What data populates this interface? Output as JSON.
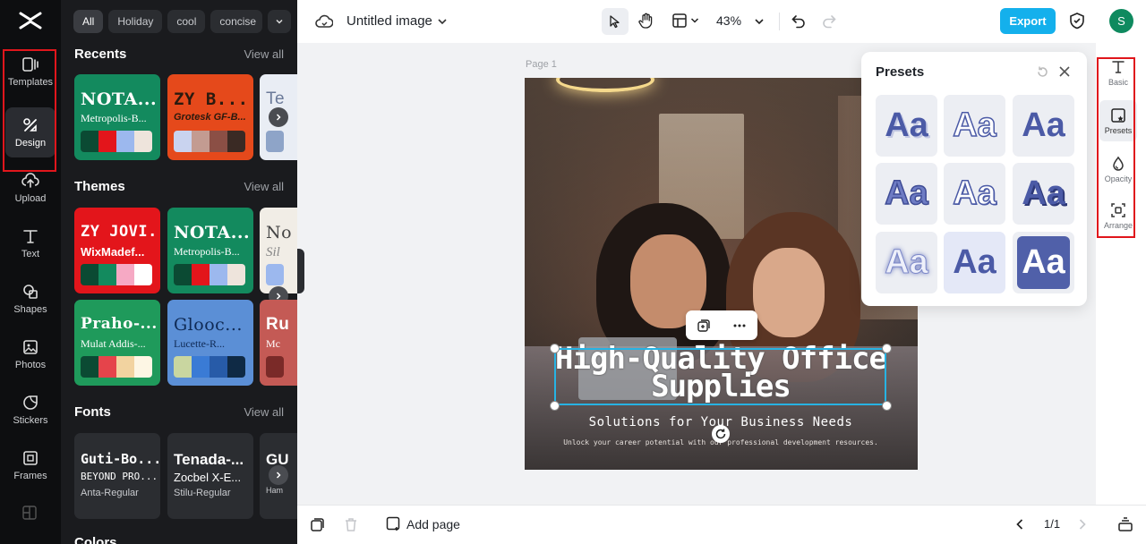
{
  "rail": {
    "items": [
      {
        "label": "Templates",
        "icon": "templates-icon"
      },
      {
        "label": "Design",
        "icon": "design-icon"
      },
      {
        "label": "Upload",
        "icon": "upload-icon"
      },
      {
        "label": "Text",
        "icon": "text-icon"
      },
      {
        "label": "Shapes",
        "icon": "shapes-icon"
      },
      {
        "label": "Photos",
        "icon": "photos-icon"
      },
      {
        "label": "Stickers",
        "icon": "stickers-icon"
      },
      {
        "label": "Frames",
        "icon": "frames-icon"
      }
    ]
  },
  "panel": {
    "chips": [
      "All",
      "Holiday",
      "cool",
      "concise"
    ],
    "recents": {
      "title": "Recents",
      "view_all": "View all",
      "cards": [
        {
          "t1": "NOTA...",
          "t2": "Metropolis-B...",
          "bg": "#138a5e",
          "fg": "#ffffff",
          "colors": [
            "#0b4a33",
            "#e3151b",
            "#9cb8ee",
            "#eee4dc"
          ]
        },
        {
          "t1": "ZY B...",
          "t2": "Grotesk GF-B...",
          "bg": "#e5491b",
          "fg": "#2a1a0f",
          "colors": [
            "#c9d3ef",
            "#c39b91",
            "#8b4f45",
            "#3a2a24"
          ]
        },
        {
          "t1": "Te",
          "t2": "",
          "bg": "#e9edf4",
          "fg": "#6b7a99",
          "colors": [
            "#8ea4c8"
          ]
        }
      ]
    },
    "themes": {
      "title": "Themes",
      "view_all": "View all",
      "cards": [
        {
          "t1": "ZY JOVI...",
          "t2": "WixMadef...",
          "bg": "#e3151b",
          "fg": "#ffffff",
          "colors": [
            "#0b4a33",
            "#138a5e",
            "#f6a9c4",
            "#ffffff"
          ]
        },
        {
          "t1": "NOTA...",
          "t2": "Metropolis-B...",
          "bg": "#138a5e",
          "fg": "#ffffff",
          "colors": [
            "#0b4a33",
            "#e3151b",
            "#9cb8ee",
            "#eee4dc"
          ]
        },
        {
          "t1": "No",
          "t2": "Sil",
          "bg": "#f1ede6",
          "fg": "#444444",
          "colors": [
            "#9cb8ee"
          ]
        },
        {
          "t1": "Praho-...",
          "t2": "Mulat Addis-...",
          "bg": "#1f9a5b",
          "fg": "#ffffff",
          "colors": [
            "#0b4a33",
            "#e5444b",
            "#f2d3a0",
            "#fdf6e4"
          ]
        },
        {
          "t1": "Glooc...",
          "t2": "Lucette-R...",
          "bg": "#5b8fd6",
          "fg": "#0f2a55",
          "colors": [
            "#c9d6a0",
            "#3a7bd5",
            "#275ba8",
            "#0f2a45"
          ]
        },
        {
          "t1": "Ru",
          "t2": "Mc",
          "bg": "#c45a55",
          "fg": "#ffffff",
          "colors": [
            "#7a2a28"
          ]
        }
      ]
    },
    "fonts": {
      "title": "Fonts",
      "view_all": "View all",
      "cards": [
        {
          "f1": "Guti-Bo...",
          "f2": "BEYOND PRO...",
          "f3": "Anta-Regular"
        },
        {
          "f1": "Tenada-...",
          "f2": "Zocbel X-E...",
          "f3": "Stilu-Regular"
        },
        {
          "f1": "GU",
          "f2": "",
          "f3": "Ham"
        }
      ]
    },
    "colors_title": "Colors"
  },
  "topbar": {
    "doc_title": "Untitled image",
    "zoom": "43%",
    "export_label": "Export",
    "avatar_initial": "S"
  },
  "canvas": {
    "page_label": "Page 1",
    "headline": "High-Quality Office Supplies",
    "subtitle": "Solutions for Your Business Needs",
    "tagline": "Unlock your career potential with our professional development resources."
  },
  "presets": {
    "title": "Presets",
    "sample": "Aa"
  },
  "right_rail": {
    "items": [
      {
        "label": "Basic",
        "icon": "text-icon"
      },
      {
        "label": "Presets",
        "icon": "presets-icon"
      },
      {
        "label": "Opacity",
        "icon": "opacity-icon"
      },
      {
        "label": "Arrange",
        "icon": "arrange-icon"
      }
    ]
  },
  "bottombar": {
    "add_page": "Add page",
    "page_counter": "1/1"
  },
  "colors": {
    "accent": "#14b0ec",
    "highlight": "#e0161c",
    "selection": "#27b3e3"
  }
}
